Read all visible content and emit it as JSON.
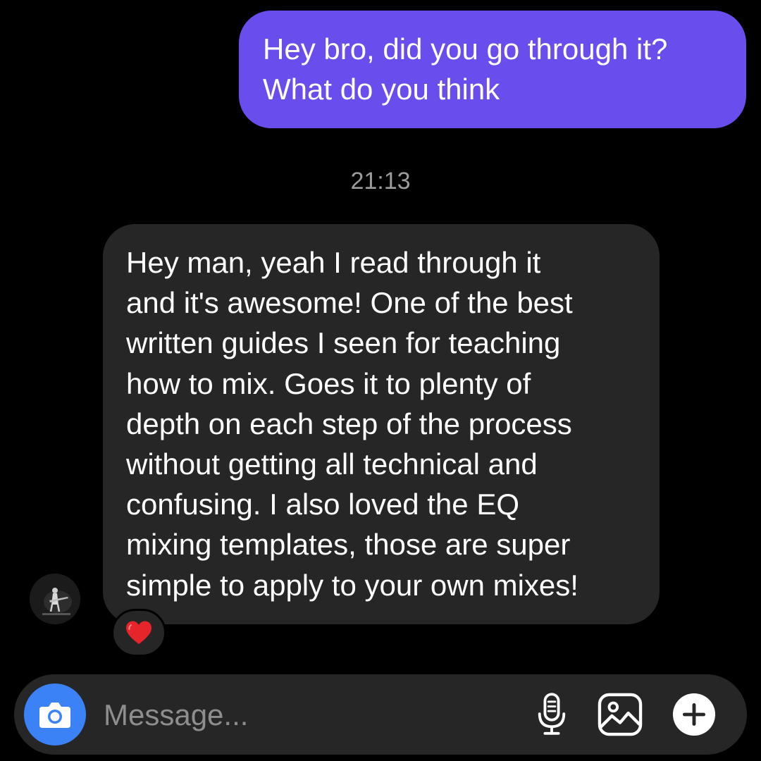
{
  "sent_message": {
    "lines": [
      "Hey bro, did you go through it?",
      "What do you think"
    ]
  },
  "timestamp": "21:13",
  "received_message": {
    "lines": [
      "Hey man, yeah I read through it",
      "and it's awesome! One of the best",
      "written guides I seen for teaching",
      "how to mix. Goes it to plenty of",
      "depth on each step of the process",
      "without getting all technical and",
      "confusing. I also loved the EQ",
      "mixing templates, those are super",
      "simple to apply to your own mixes!"
    ],
    "reaction": "heart-icon"
  },
  "composer": {
    "placeholder": "Message...",
    "buttons": [
      "camera-icon",
      "microphone-icon",
      "gallery-icon",
      "plus-icon"
    ]
  },
  "colors": {
    "background": "#000000",
    "sent_bubble": "#6a4ded",
    "received_bubble": "#262626",
    "timestamp": "#9b9b9b",
    "camera_button": "#3b82f6",
    "heart": "#e5252a"
  }
}
